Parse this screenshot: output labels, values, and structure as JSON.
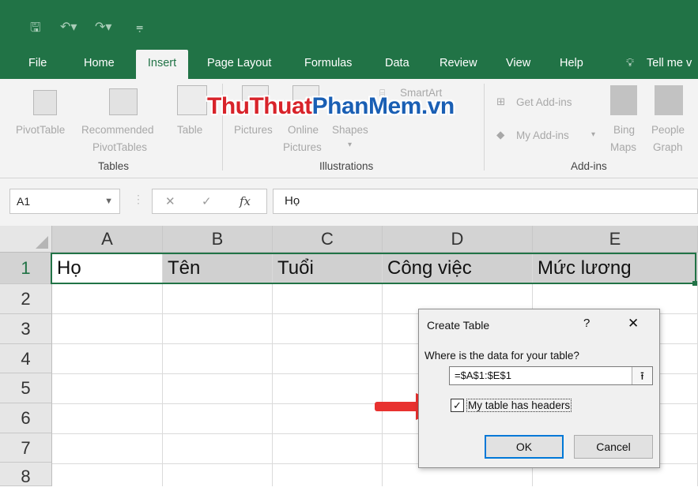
{
  "ribbon_tabs": [
    "File",
    "Home",
    "Insert",
    "Page Layout",
    "Formulas",
    "Data",
    "Review",
    "View",
    "Help",
    "Tell me v"
  ],
  "active_tab": "Insert",
  "ribbon": {
    "pivot_table": "PivotTable",
    "recommended_line1": "Recommended",
    "recommended_line2": "PivotTables",
    "table": "Table",
    "pictures": "Pictures",
    "online_line1": "Online",
    "online_line2": "Pictures",
    "shapes": "Shapes",
    "smartart": "SmartArt",
    "get_addins": "Get Add-ins",
    "my_addins": "My Add-ins",
    "bing_line1": "Bing",
    "bing_line2": "Maps",
    "people_line1": "People",
    "people_line2": "Graph",
    "group_tables": "Tables",
    "group_illustrations": "Illustrations",
    "group_addins": "Add-ins"
  },
  "watermark": {
    "red1": "Thu",
    "red2": "Thuat",
    "blue1": "Phan",
    "blue2": "Mem",
    "suffix": ".vn"
  },
  "formula_bar": {
    "name_box": "A1",
    "fx": "fx",
    "content": "Họ"
  },
  "columns": [
    "A",
    "B",
    "C",
    "D",
    "E"
  ],
  "rows": [
    "1",
    "2",
    "3",
    "4",
    "5",
    "6",
    "7",
    "8"
  ],
  "row1": [
    "Họ",
    "Tên",
    "Tuổi",
    "Công việc",
    "Mức lương"
  ],
  "dialog": {
    "title": "Create Table",
    "help": "?",
    "close": "✕",
    "prompt": "Where is the data for your table?",
    "range": "=$A$1:$E$1",
    "collapse_icon": "🡅",
    "checkbox_label": "My table has headers",
    "checked": true,
    "ok": "OK",
    "cancel": "Cancel"
  },
  "colors": {
    "excel_green": "#217346",
    "arrow_red": "#e8312f"
  }
}
